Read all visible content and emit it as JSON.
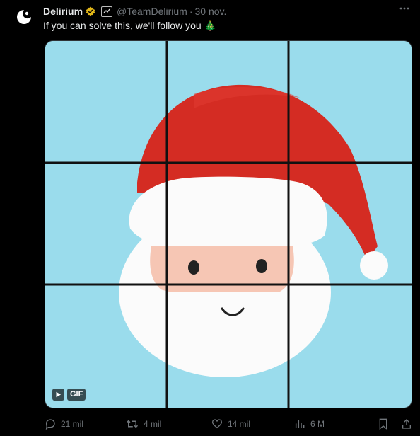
{
  "author": {
    "name": "Delirium",
    "handle": "@TeamDelirium",
    "separator": "·",
    "date": "30 nov."
  },
  "tweet_text": "If you can solve this, we'll follow you 🎄",
  "media": {
    "badge_label": "GIF",
    "grid": "3x3"
  },
  "actions": {
    "replies": "21 mil",
    "retweets": "4 mil",
    "likes": "14 mil",
    "views": "6 M"
  },
  "colors": {
    "background": "#000000",
    "text": "#e7e9ea",
    "muted": "#71767b",
    "verified": "#e2b719",
    "media_bg": "#9adcec",
    "santa_hat": "#d42c23"
  }
}
